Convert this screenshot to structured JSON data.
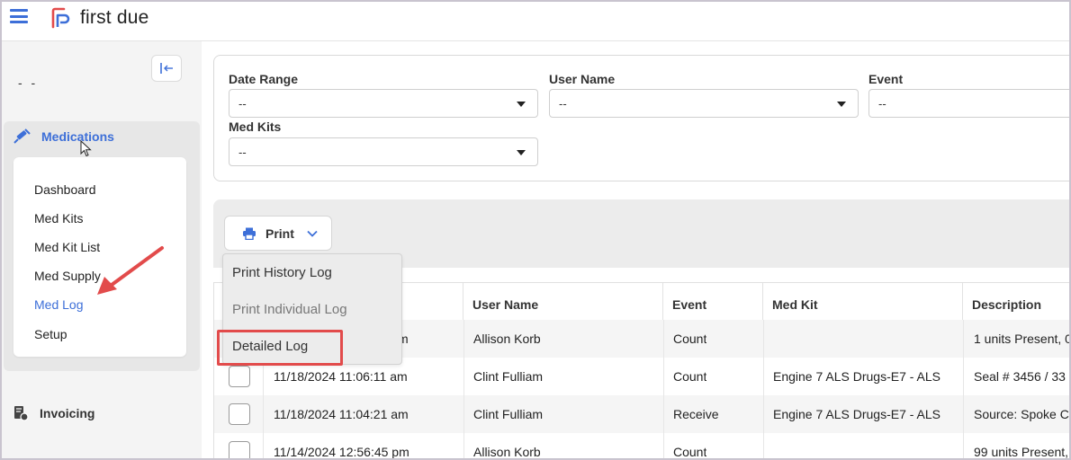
{
  "app": {
    "name": "first due"
  },
  "sidebar": {
    "placeholder": "- -",
    "section": {
      "label": "Medications"
    },
    "items": [
      {
        "label": "Dashboard"
      },
      {
        "label": "Med Kits"
      },
      {
        "label": "Med Kit List"
      },
      {
        "label": "Med Supply"
      },
      {
        "label": "Med Log",
        "active": true
      },
      {
        "label": "Setup"
      }
    ],
    "invoicing": {
      "label": "Invoicing"
    }
  },
  "filters": {
    "date_range": {
      "label": "Date Range",
      "value": "--"
    },
    "user_name": {
      "label": "User Name",
      "value": "--"
    },
    "event": {
      "label": "Event",
      "value": "--"
    },
    "med_kits": {
      "label": "Med Kits",
      "value": "--"
    }
  },
  "actions": {
    "print_label": "Print",
    "print_menu": [
      {
        "label": "Print History Log"
      },
      {
        "label": "Print Individual Log"
      },
      {
        "label": "Detailed Log"
      }
    ]
  },
  "table": {
    "columns": [
      "",
      "User Name",
      "Event",
      "Med Kit",
      "Description"
    ],
    "rows": [
      {
        "date_fragment": "m",
        "user": "Allison Korb",
        "event": "Count",
        "medkit": "",
        "description": "1 units Present, 0"
      },
      {
        "date": "11/18/2024 11:06:11 am",
        "user": "Clint Fulliam",
        "event": "Count",
        "medkit": "Engine 7 ALS Drugs-E7 - ALS",
        "description": "Seal # 3456 / 33 u"
      },
      {
        "date": "11/18/2024 11:04:21 am",
        "user": "Clint Fulliam",
        "event": "Receive",
        "medkit": "Engine 7 ALS Drugs-E7 - ALS",
        "description": "Source: Spoke Co"
      },
      {
        "date": "11/14/2024 12:56:45 pm",
        "user": "Allison Korb",
        "event": "Count",
        "medkit": "",
        "description": "99 units Present,"
      }
    ]
  },
  "colors": {
    "accent": "#3d6fd8",
    "logo_red": "#e24b4b",
    "annotation_red": "#e24b4b"
  }
}
